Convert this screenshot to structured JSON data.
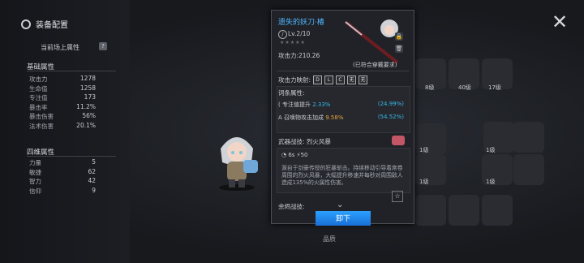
{
  "panel": {
    "title": "装备配置",
    "current_label": "当前场上属性"
  },
  "basic": {
    "title": "基础属性",
    "rows": [
      {
        "k": "攻击力",
        "v": "1278"
      },
      {
        "k": "生命值",
        "v": "1258"
      },
      {
        "k": "专注值",
        "v": "173"
      },
      {
        "k": "暴击率",
        "v": "11.2%"
      },
      {
        "k": "暴击伤害",
        "v": "56%"
      },
      {
        "k": "法术伤害",
        "v": "20.1%"
      }
    ]
  },
  "four": {
    "title": "四维属性",
    "rows": [
      {
        "k": "力量",
        "v": "5"
      },
      {
        "k": "敏捷",
        "v": "62"
      },
      {
        "k": "智力",
        "v": "42"
      },
      {
        "k": "信仰",
        "v": "9"
      }
    ]
  },
  "popup": {
    "name": "遗失的妖刀·椿",
    "level": "Lv.2/10",
    "stars": "★★★★★",
    "atk": "攻击力:210.26",
    "requirement": "(已符合穿戴要求)",
    "resonance_label": "攻击力映射:",
    "resonance_tags": [
      "D",
      "L",
      "C",
      "无",
      "无"
    ],
    "affix_title": "词条属性:",
    "affixes": [
      {
        "name": "专注值提升",
        "value": "2.33%",
        "total": "(24.99%)"
      },
      {
        "name": "召唤物攻击加成",
        "value": "9.58%",
        "total": "(54.52%)"
      }
    ],
    "weapon_skill_label": "武器战技:",
    "weapon_skill": "烈火风暴",
    "cooldown": "6s",
    "cost": "50",
    "description": "源自于剑豪传授的狂暴斩击。持续移动引导着席卷周围的烈火风暴，大幅提升移速并每秒对周围敌人造成135%的火属性伤害。",
    "spare_label": "余烬战技:",
    "unequip": "卸下"
  },
  "grid_levels": [
    "8级",
    "40级",
    "17级",
    "1级",
    "1级",
    "1级",
    "1级"
  ],
  "quality_label": "品质"
}
